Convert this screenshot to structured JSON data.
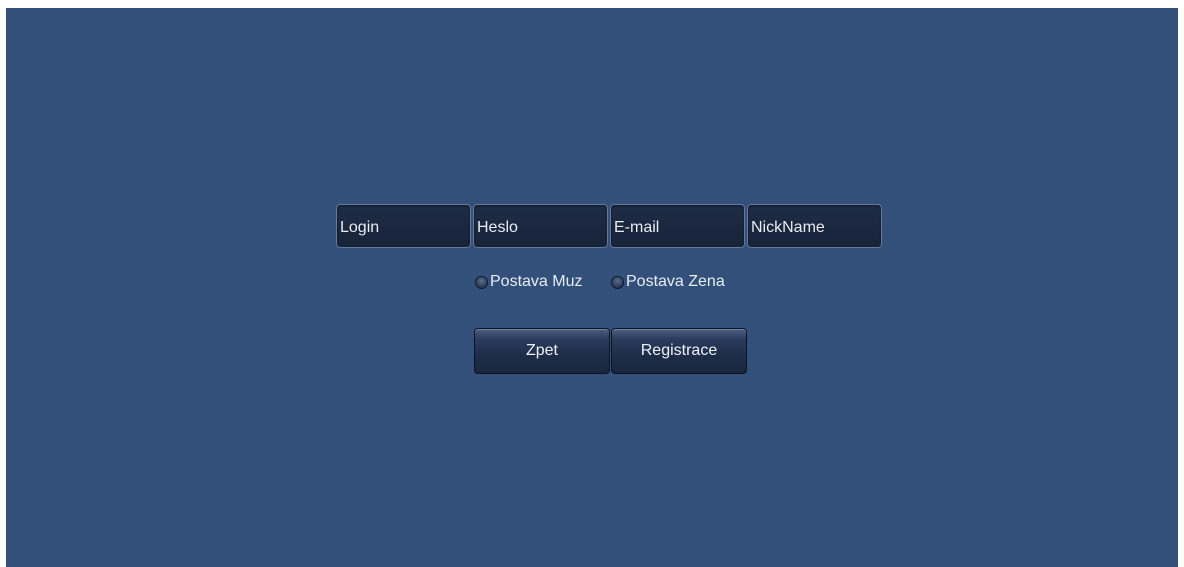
{
  "form": {
    "login_placeholder": "Login",
    "password_placeholder": "Heslo",
    "email_placeholder": "E-mail",
    "nickname_placeholder": "NickName",
    "option_male_label": "Postava Muz",
    "option_female_label": "Postava Zena",
    "back_label": "Zpet",
    "register_label": "Registrace"
  },
  "colors": {
    "background": "#325079",
    "field_background": "#1b2840",
    "text": "#e8ecf4"
  }
}
